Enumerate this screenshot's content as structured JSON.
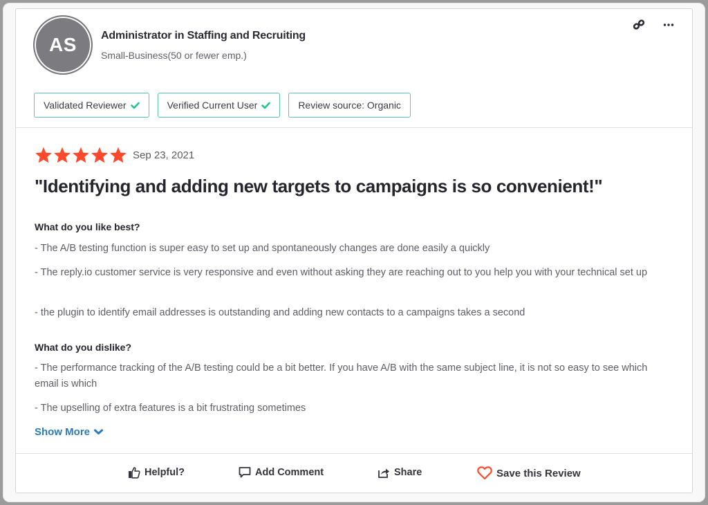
{
  "reviewer": {
    "initials": "AS",
    "title": "Administrator in Staffing and Recruiting",
    "company_size": "Small-Business(50 or fewer emp.)"
  },
  "header_icons": {
    "link": "link-icon",
    "more": "more-options-icon"
  },
  "badges": [
    {
      "label": "Validated Reviewer",
      "checked": true
    },
    {
      "label": "Verified Current User",
      "checked": true
    },
    {
      "label": "Review source: Organic",
      "checked": false
    }
  ],
  "review": {
    "rating": 5,
    "rating_max": 5,
    "date": "Sep 23, 2021",
    "title": "\"Identifying and adding new targets to campaigns is so convenient!\"",
    "sections": [
      {
        "question": "What do you like best?",
        "answers": [
          "- The A/B testing function is super easy to set up and spontaneously changes are done easily a quickly",
          "- The reply.io customer service is very responsive and even without asking they are reaching out to you help you with your technical set up",
          "- the plugin to identify email addresses is outstanding and adding new contacts to a campaigns takes a second"
        ]
      },
      {
        "question": "What do you dislike?",
        "answers": [
          "- The performance tracking of the A/B testing could be a bit better. If you have A/B with the same subject line, it is not so easy to see which email is which",
          "- The upselling of extra features is a bit frustrating sometimes"
        ]
      }
    ],
    "show_more_label": "Show More"
  },
  "actions": {
    "helpful": "Helpful?",
    "add_comment": "Add Comment",
    "share": "Share",
    "save": "Save this Review"
  },
  "colors": {
    "star": "#ff492c",
    "badge_border": "#58c9a8",
    "check": "#27c095",
    "link": "#2d7ab8",
    "heart": "#ff492c"
  }
}
